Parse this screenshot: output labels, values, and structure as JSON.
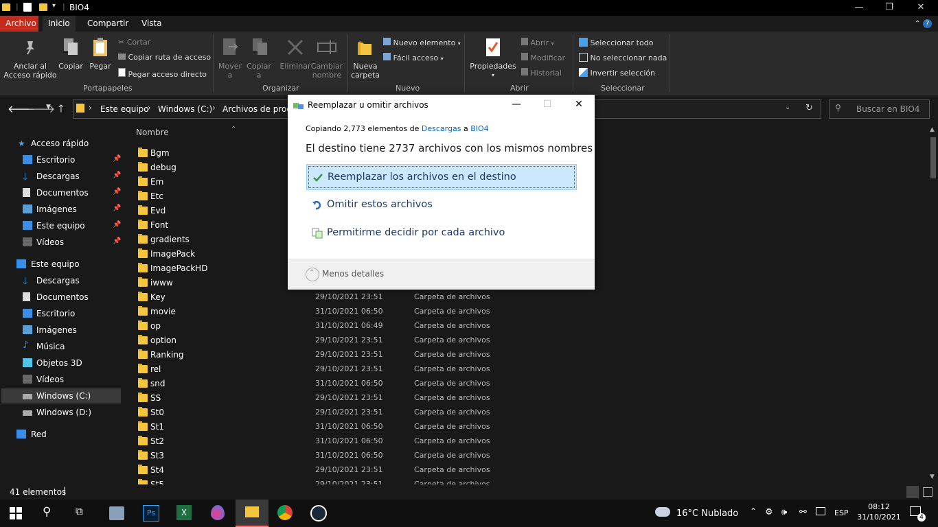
{
  "window": {
    "title": "BIO4",
    "minimize": "—",
    "maximize": "❐",
    "close": "✕"
  },
  "tabs": [
    "Archivo",
    "Inicio",
    "Compartir",
    "Vista"
  ],
  "ribbon": {
    "pin": "Anclar al\nAcceso rápido",
    "pin_l1": "Anclar al",
    "pin_l2": "Acceso rápido",
    "copy": "Copiar",
    "paste": "Pegar",
    "cut": "Cortar",
    "copy_path": "Copiar ruta de acceso",
    "paste_shortcut": "Pegar acceso directo",
    "group_clipboard": "Portapapeles",
    "move_l1": "Mover",
    "move_l2": "a",
    "copyto_l1": "Copiar",
    "copyto_l2": "a",
    "delete": "Eliminar",
    "rename_l1": "Cambiar",
    "rename_l2": "nombre",
    "group_organize": "Organizar",
    "newfolder_l1": "Nueva",
    "newfolder_l2": "carpeta",
    "new_item": "Nuevo elemento",
    "easy_access": "Fácil acceso",
    "group_new": "Nuevo",
    "properties": "Propiedades",
    "open": "Abrir",
    "edit": "Modificar",
    "history": "Historial",
    "group_open": "Abrir",
    "select_all": "Seleccionar todo",
    "select_none": "No seleccionar nada",
    "invert": "Invertir selección",
    "group_select": "Seleccionar"
  },
  "address": {
    "crumbs": [
      "Este equipo",
      "Windows (C:)",
      "Archivos de progr"
    ],
    "search_placeholder": "Buscar en BIO4"
  },
  "nav": {
    "quick_access": "Acceso rápido",
    "quick_items": [
      "Escritorio",
      "Descargas",
      "Documentos",
      "Imágenes",
      "Este equipo",
      "Vídeos"
    ],
    "this_pc": "Este equipo",
    "pc_items": [
      "Descargas",
      "Documentos",
      "Escritorio",
      "Imágenes",
      "Música",
      "Objetos 3D",
      "Vídeos",
      "Windows (C:)",
      "Windows (D:)"
    ],
    "network": "Red"
  },
  "filelist": {
    "col_name": "Nombre",
    "rows": [
      {
        "name": "Bgm",
        "date": "",
        "type": ""
      },
      {
        "name": "debug",
        "date": "",
        "type": ""
      },
      {
        "name": "Em",
        "date": "",
        "type": ""
      },
      {
        "name": "Etc",
        "date": "",
        "type": ""
      },
      {
        "name": "Evd",
        "date": "",
        "type": ""
      },
      {
        "name": "Font",
        "date": "",
        "type": ""
      },
      {
        "name": "gradients",
        "date": "",
        "type": ""
      },
      {
        "name": "ImagePack",
        "date": "",
        "type": ""
      },
      {
        "name": "ImagePackHD",
        "date": "",
        "type": ""
      },
      {
        "name": "iwww",
        "date": "",
        "type": ""
      },
      {
        "name": "Key",
        "date": "29/10/2021 23:51",
        "type": "Carpeta de archivos"
      },
      {
        "name": "movie",
        "date": "31/10/2021 06:50",
        "type": "Carpeta de archivos"
      },
      {
        "name": "op",
        "date": "31/10/2021 06:49",
        "type": "Carpeta de archivos"
      },
      {
        "name": "option",
        "date": "29/10/2021 23:51",
        "type": "Carpeta de archivos"
      },
      {
        "name": "Ranking",
        "date": "29/10/2021 23:51",
        "type": "Carpeta de archivos"
      },
      {
        "name": "rel",
        "date": "29/10/2021 23:51",
        "type": "Carpeta de archivos"
      },
      {
        "name": "snd",
        "date": "31/10/2021 06:50",
        "type": "Carpeta de archivos"
      },
      {
        "name": "SS",
        "date": "29/10/2021 23:51",
        "type": "Carpeta de archivos"
      },
      {
        "name": "St0",
        "date": "29/10/2021 23:51",
        "type": "Carpeta de archivos"
      },
      {
        "name": "St1",
        "date": "31/10/2021 06:50",
        "type": "Carpeta de archivos"
      },
      {
        "name": "St2",
        "date": "31/10/2021 06:50",
        "type": "Carpeta de archivos"
      },
      {
        "name": "St3",
        "date": "31/10/2021 06:50",
        "type": "Carpeta de archivos"
      },
      {
        "name": "St4",
        "date": "29/10/2021 23:51",
        "type": "Carpeta de archivos"
      },
      {
        "name": "St5",
        "date": "29/10/2021 23:51",
        "type": "Carpeta de archivos"
      }
    ]
  },
  "status": {
    "count": "41 elementos"
  },
  "dialog": {
    "title": "Reemplazar u omitir archivos",
    "copy_prefix": "Copiando 2,773 elementos de ",
    "copy_from": "Descargas",
    "copy_mid": " a ",
    "copy_to": "BIO4",
    "dest_msg": "El destino tiene 2737 archivos con los mismos nombres",
    "opt_replace": "Reemplazar los archivos en el destino",
    "opt_skip": "Omitir estos archivos",
    "opt_decide": "Permitirme decidir por cada archivo",
    "less_details": "Menos detalles"
  },
  "taskbar": {
    "weather": "16°C  Nublado",
    "lang": "ESP",
    "time": "08:12",
    "date": "31/10/2021",
    "notif_count": "4"
  }
}
